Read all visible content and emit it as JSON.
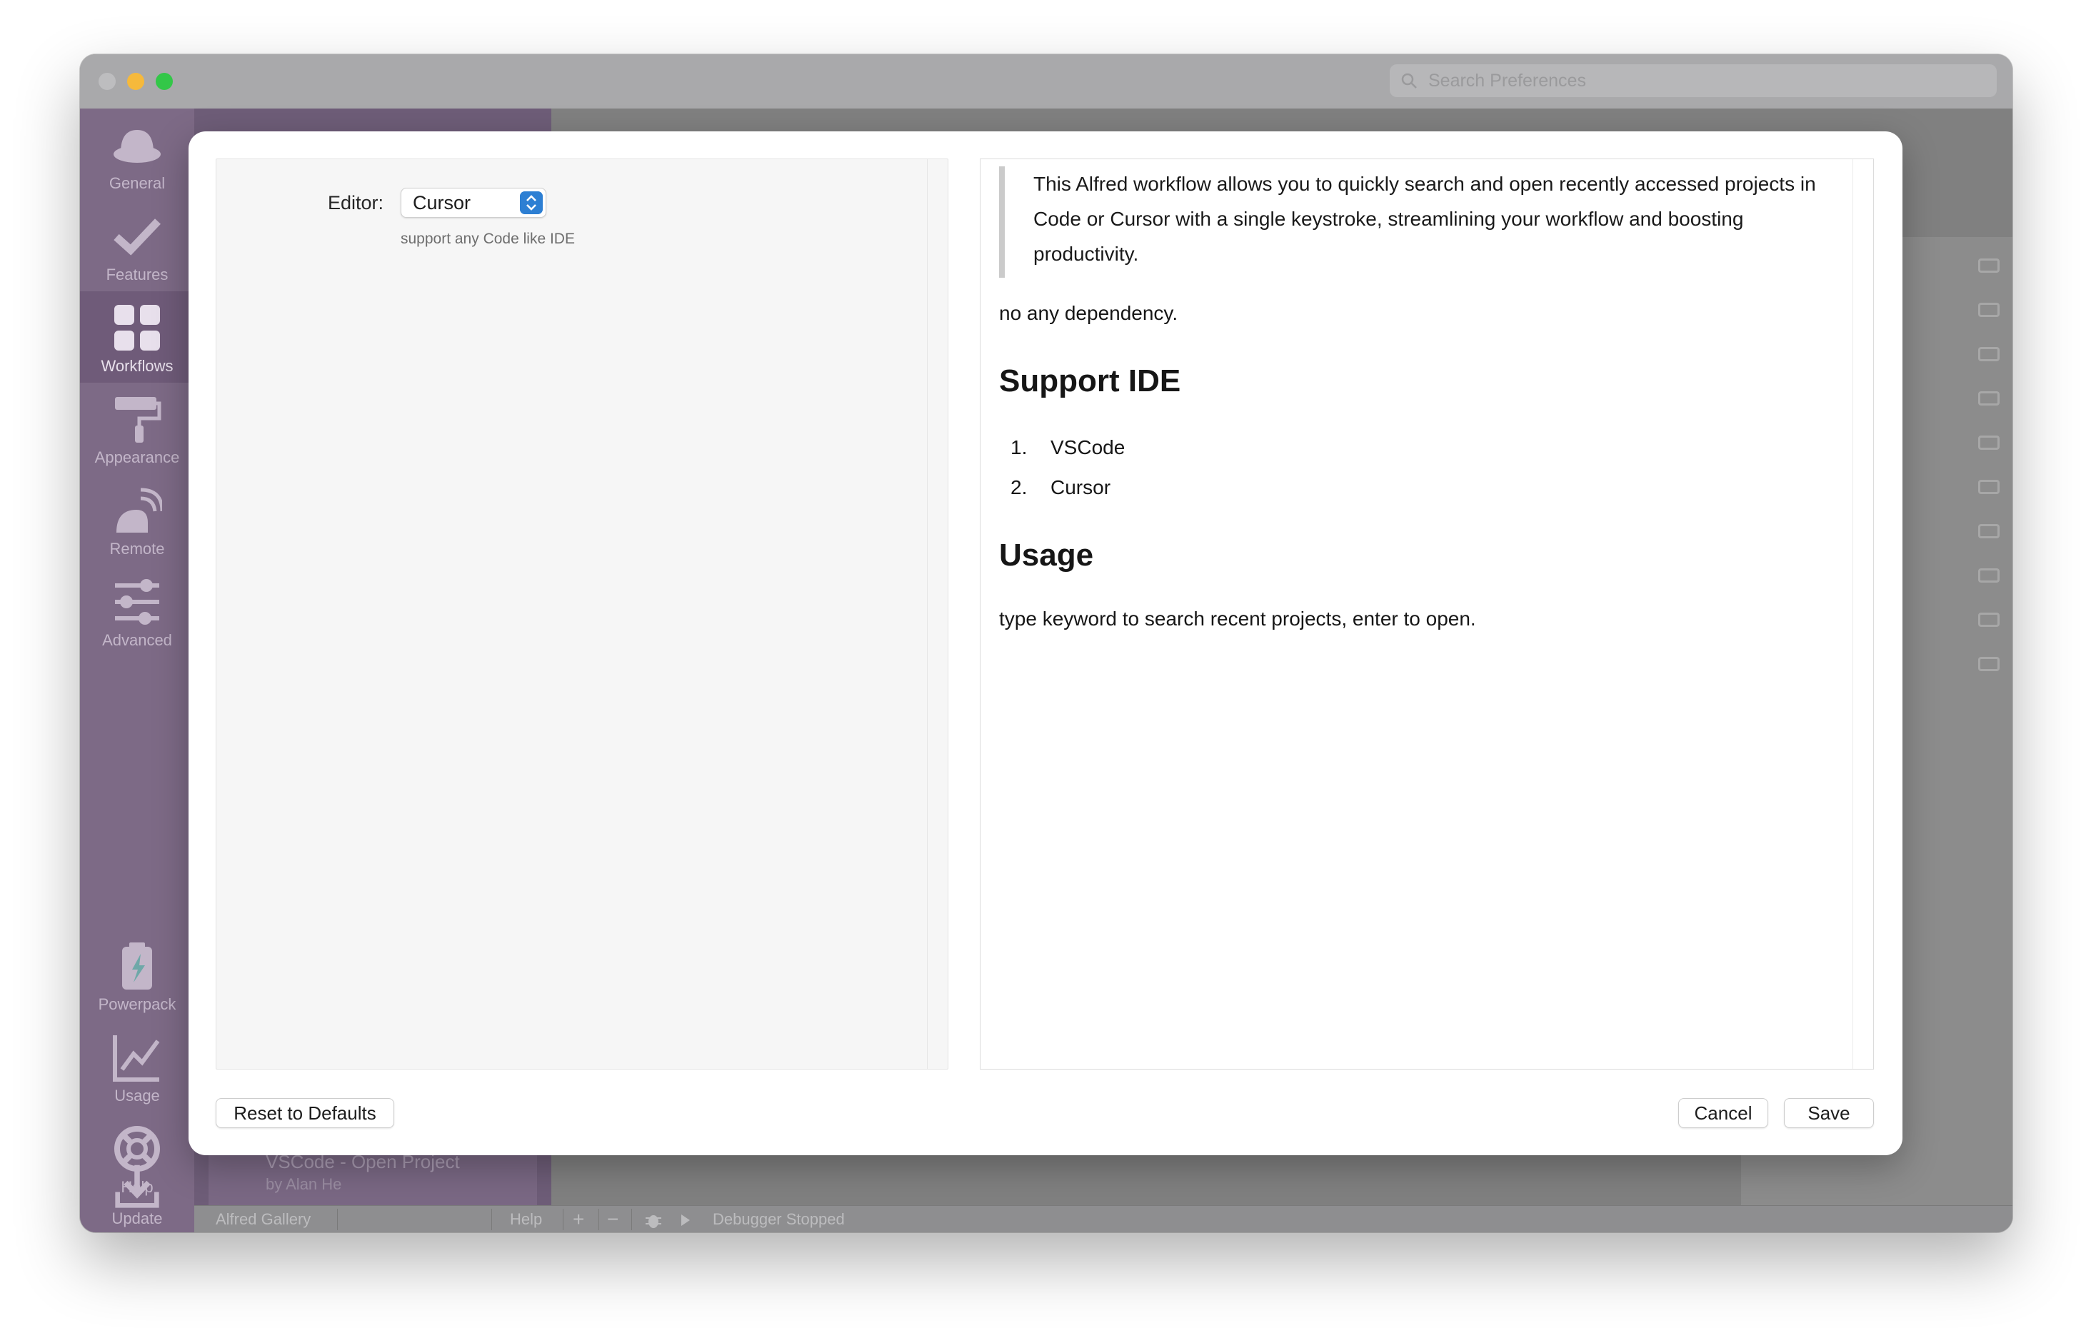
{
  "window": {
    "search_placeholder": "Search Preferences"
  },
  "sidebar": {
    "items": [
      {
        "label": "General",
        "icon": "hat-icon"
      },
      {
        "label": "Features",
        "icon": "checkmark-icon"
      },
      {
        "label": "Workflows",
        "icon": "grid-icon"
      },
      {
        "label": "Appearance",
        "icon": "paint-roller-icon"
      },
      {
        "label": "Remote",
        "icon": "remote-icon"
      },
      {
        "label": "Advanced",
        "icon": "sliders-icon"
      },
      {
        "label": "Powerpack",
        "icon": "battery-icon"
      },
      {
        "label": "Usage",
        "icon": "chart-icon"
      },
      {
        "label": "Help",
        "icon": "lifebuoy-icon"
      },
      {
        "label": "Update",
        "icon": "download-icon"
      }
    ]
  },
  "workflow_list": {
    "entry_title": "VSCode - Open Project",
    "entry_author": "by Alan He"
  },
  "bottom_bar": {
    "gallery": "Alfred Gallery",
    "help": "Help",
    "add": "+",
    "remove": "−",
    "debugger_status": "Debugger Stopped"
  },
  "dialog": {
    "editor_label": "Editor:",
    "editor_value": "Cursor",
    "editor_hint": "support any Code like IDE",
    "readme": {
      "blockquote": "This Alfred workflow allows you to quickly search and open recently accessed projects in Code or Cursor with a single keystroke, streamlining your workflow and boosting productivity.",
      "paragraph1": "no any dependency.",
      "heading1": "Support IDE",
      "list": [
        {
          "num": "1.",
          "text": "VSCode"
        },
        {
          "num": "2.",
          "text": "Cursor"
        }
      ],
      "heading2": "Usage",
      "paragraph2": "type keyword to search recent projects, enter to open."
    },
    "reset_label": "Reset to Defaults",
    "cancel_label": "Cancel",
    "save_label": "Save"
  }
}
